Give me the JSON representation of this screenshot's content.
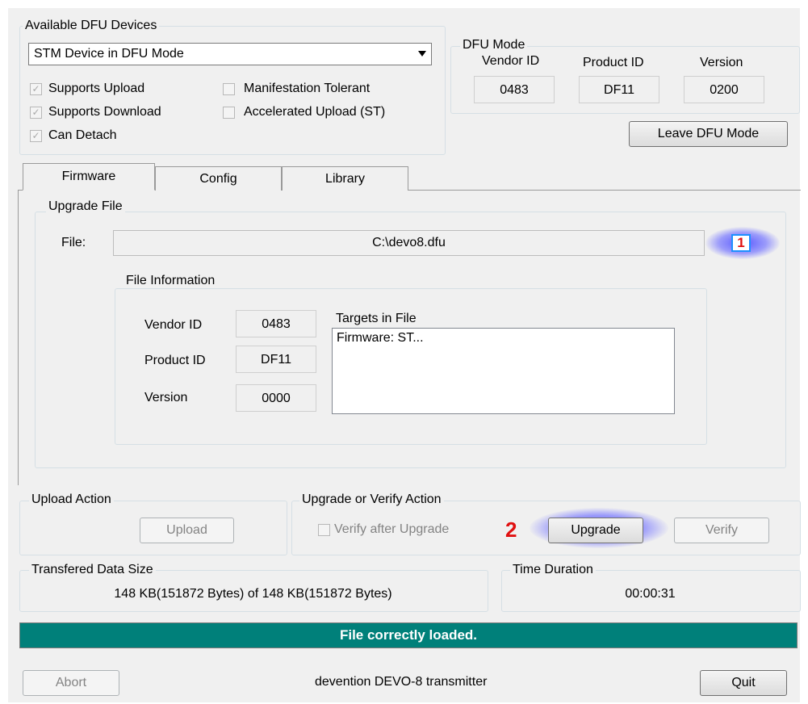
{
  "devices": {
    "group_label": "Available DFU Devices",
    "selected": "STM Device in DFU Mode",
    "checks": [
      {
        "label": "Supports Upload",
        "checked": "✓"
      },
      {
        "label": "Supports Download",
        "checked": "✓"
      },
      {
        "label": "Can Detach",
        "checked": "✓"
      },
      {
        "label": "Manifestation Tolerant",
        "checked": ""
      },
      {
        "label": "Accelerated Upload (ST)",
        "checked": ""
      }
    ]
  },
  "dfu_mode": {
    "group_label": "DFU Mode",
    "vendor_label": "Vendor ID",
    "vendor": "0483",
    "product_label": "Product ID",
    "product": "DF11",
    "version_label": "Version",
    "version": "0200",
    "leave_button": "Leave DFU Mode"
  },
  "tabs": [
    "Firmware",
    "Config",
    "Library"
  ],
  "upgrade_file": {
    "group_label": "Upgrade File",
    "file_label": "File:",
    "file_value": "C:\\devo8.dfu",
    "info_label": "File Information",
    "vendor_label": "Vendor ID",
    "vendor": "0483",
    "product_label": "Product ID",
    "product": "DF11",
    "version_label": "Version",
    "version": "0000",
    "targets_label": "Targets in File",
    "targets": [
      "Firmware: ST..."
    ]
  },
  "annotations": {
    "one": "1",
    "two": "2"
  },
  "upload_action": {
    "group_label": "Upload Action",
    "button": "Upload"
  },
  "upgrade_action": {
    "group_label": "Upgrade or Verify Action",
    "verify_check": "Verify after Upgrade",
    "upgrade_button": "Upgrade",
    "verify_button": "Verify"
  },
  "transfer": {
    "group_label": "Transfered Data Size",
    "value": "148 KB(151872 Bytes) of 148 KB(151872 Bytes)"
  },
  "duration": {
    "group_label": "Time Duration",
    "value": "00:00:31"
  },
  "status": {
    "text": "File correctly loaded.",
    "progress": 1.0,
    "color": "#00807a"
  },
  "footer": {
    "abort": "Abort",
    "device_text": "devention DEVO-8 transmitter",
    "quit": "Quit"
  }
}
